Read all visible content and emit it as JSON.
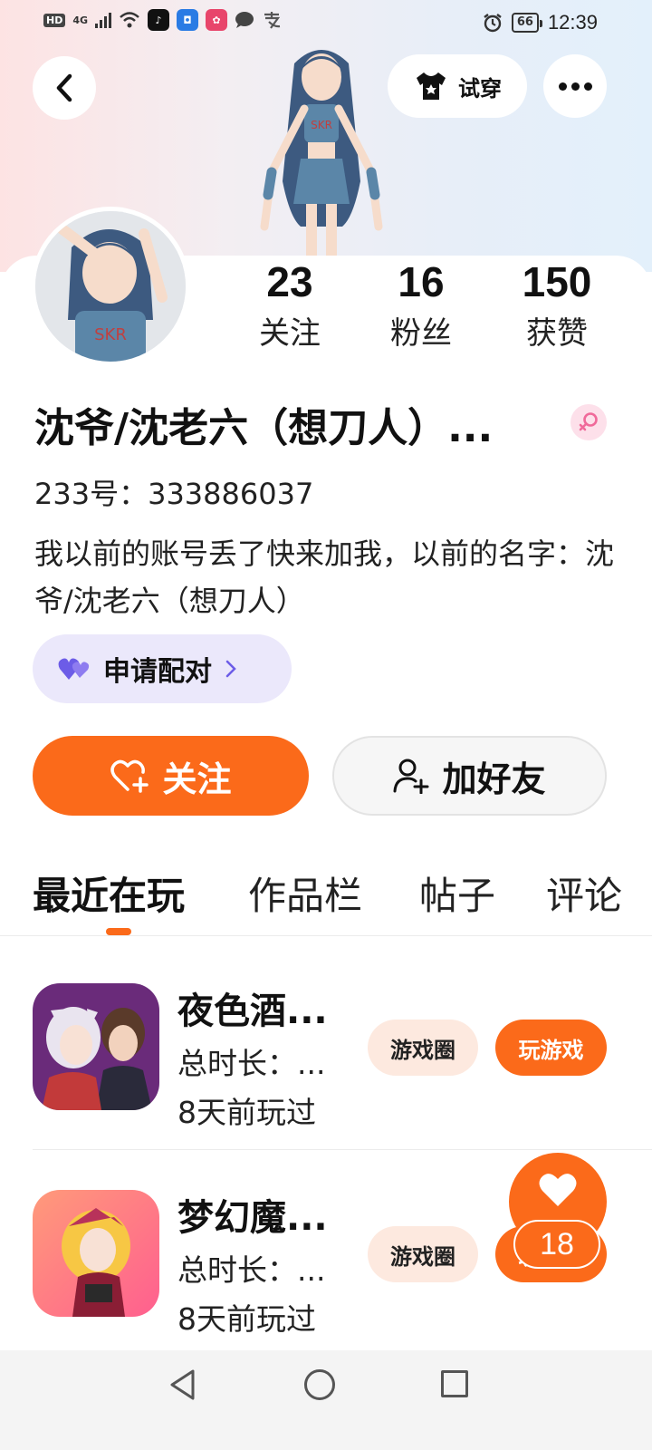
{
  "status_bar": {
    "network": "HD",
    "signal": "4G",
    "battery": "66",
    "time": "12:39"
  },
  "header": {
    "tryon_label": "试穿"
  },
  "profile": {
    "stats": [
      {
        "value": "23",
        "label": "关注"
      },
      {
        "value": "16",
        "label": "粉丝"
      },
      {
        "value": "150",
        "label": "获赞"
      }
    ],
    "name": "沈爷/沈老六（想刀人）...",
    "uid": "233号：333886037",
    "bio": "我以前的账号丢了快来加我，以前的名字：沈爷/沈老六（想刀人）",
    "pair_label": "申请配对"
  },
  "actions": {
    "follow_label": "关注",
    "add_friend_label": "加好友"
  },
  "tabs": [
    {
      "label": "最近在玩",
      "active": true
    },
    {
      "label": "作品栏",
      "active": false
    },
    {
      "label": "帖子",
      "active": false
    },
    {
      "label": "评论",
      "active": false
    }
  ],
  "games": [
    {
      "title": "夜色酒...",
      "duration": "总时长：...",
      "last_played": "8天前玩过",
      "circle_label": "游戏圈",
      "play_label": "玩游戏"
    },
    {
      "title": "梦幻魔...",
      "duration": "总时长：...",
      "last_played": "8天前玩过",
      "circle_label": "游戏圈",
      "play_label": "玩游戏"
    }
  ],
  "floating_like": {
    "count": "18"
  },
  "colors": {
    "accent": "#fb6a1a",
    "pair_bg": "#ebe8fb",
    "circle_bg": "#fde9df",
    "gender_pink": "#f06a9a"
  }
}
